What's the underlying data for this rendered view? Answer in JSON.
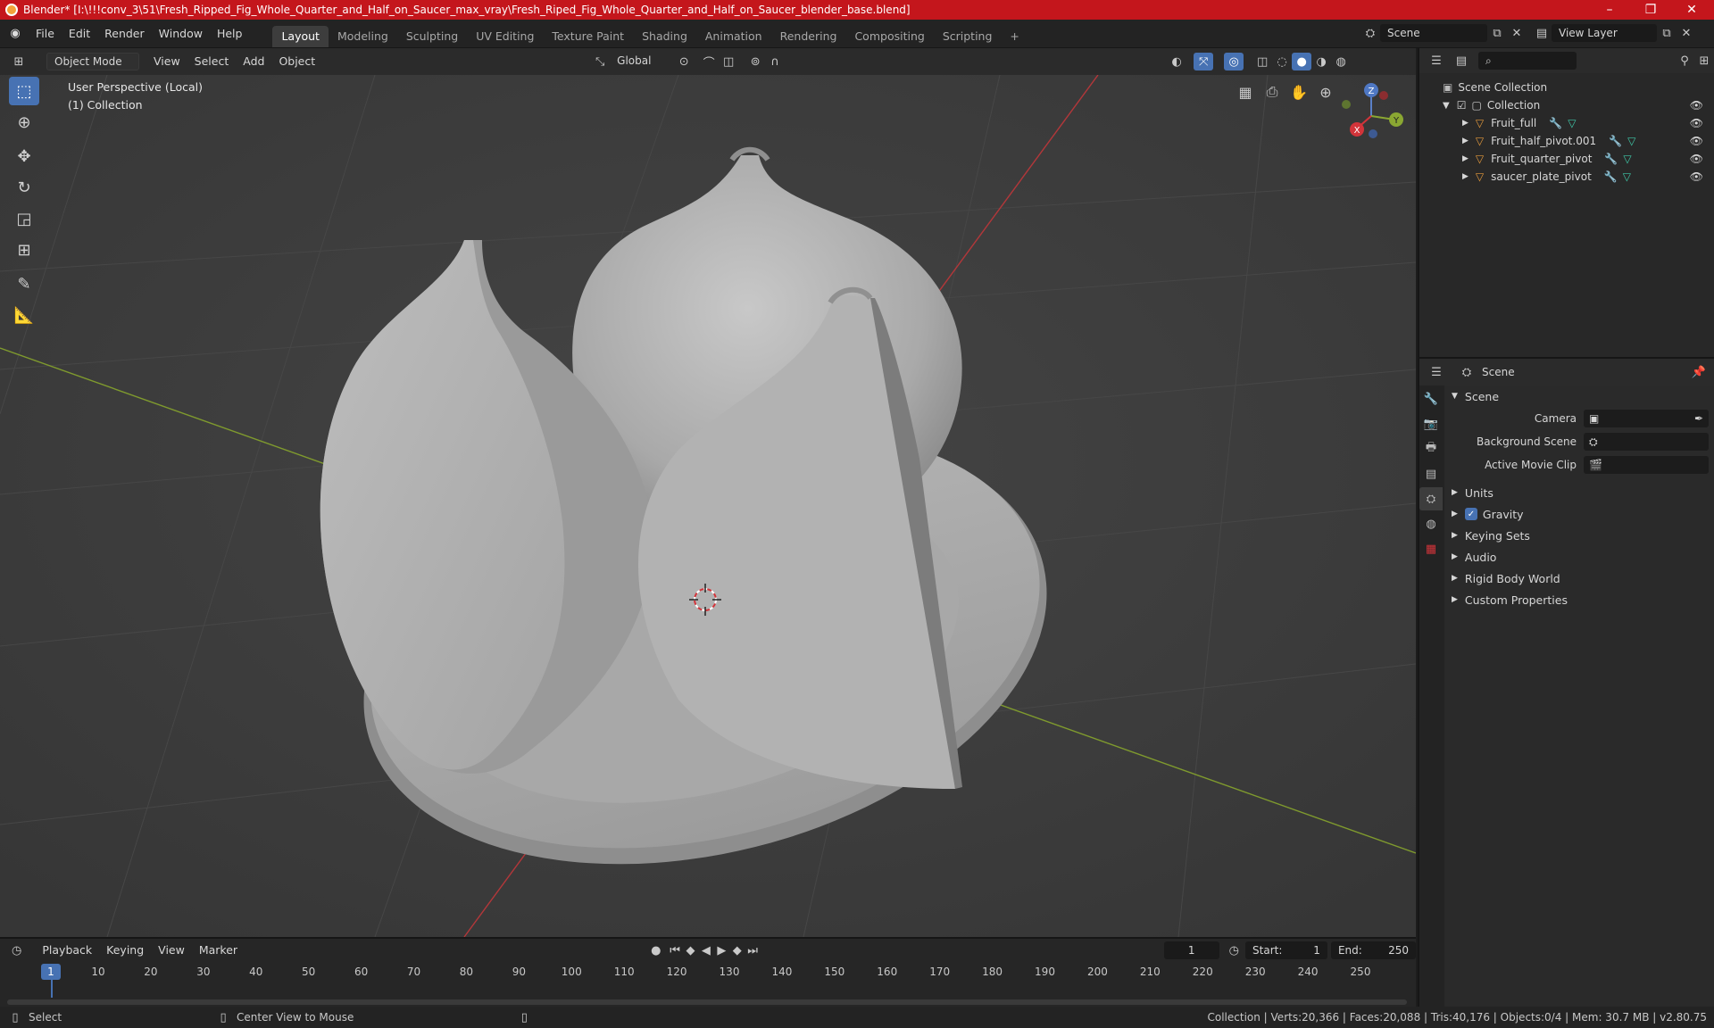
{
  "window": {
    "title": "Blender* [I:\\!!!conv_3\\51\\Fresh_Ripped_Fig_Whole_Quarter_and_Half_on_Saucer_max_vray\\Fresh_Riped_Fig_Whole_Quarter_and_Half_on_Saucer_blender_base.blend]",
    "minimize": "–",
    "maximize": "❐",
    "close": "✕"
  },
  "menu": [
    "File",
    "Edit",
    "Render",
    "Window",
    "Help"
  ],
  "workspaces": [
    "Layout",
    "Modeling",
    "Sculpting",
    "UV Editing",
    "Texture Paint",
    "Shading",
    "Animation",
    "Rendering",
    "Compositing",
    "Scripting"
  ],
  "workspace_add": "+",
  "scene_field": "Scene",
  "view_layer_field": "View Layer",
  "viewport_header": {
    "mode": "Object Mode",
    "menus": [
      "View",
      "Select",
      "Add",
      "Object"
    ],
    "orientation": "Global"
  },
  "viewport": {
    "perspective": "User Perspective (Local)",
    "collection": "(1) Collection",
    "gizmo": {
      "x": "X",
      "y": "Y",
      "z": "Z"
    }
  },
  "outliner": {
    "root": "Scene Collection",
    "collection": "Collection",
    "items": [
      "Fruit_full",
      "Fruit_half_pivot.001",
      "Fruit_quarter_pivot",
      "saucer_plate_pivot"
    ]
  },
  "properties": {
    "header": "Scene",
    "panel": "Scene",
    "camera_label": "Camera",
    "background_label": "Background Scene",
    "movie_clip_label": "Active Movie Clip",
    "subpanels": [
      "Units",
      "Gravity",
      "Keying Sets",
      "Audio",
      "Rigid Body World",
      "Custom Properties"
    ]
  },
  "timeline": {
    "menus": [
      "Playback",
      "Keying",
      "View",
      "Marker"
    ],
    "current_frame": "1",
    "start_label": "Start:",
    "start": "1",
    "end_label": "End:",
    "end": "250",
    "ticks": [
      "1",
      "10",
      "20",
      "30",
      "40",
      "50",
      "60",
      "70",
      "80",
      "90",
      "100",
      "110",
      "120",
      "130",
      "140",
      "150",
      "160",
      "170",
      "180",
      "190",
      "200",
      "210",
      "220",
      "230",
      "240",
      "250"
    ]
  },
  "statusbar": {
    "select": "Select",
    "center": "Center View to Mouse",
    "stats": "Collection | Verts:20,366 | Faces:20,088 | Tris:40,176 | Objects:0/4 | Mem: 30.7 MB | v2.80.75"
  }
}
